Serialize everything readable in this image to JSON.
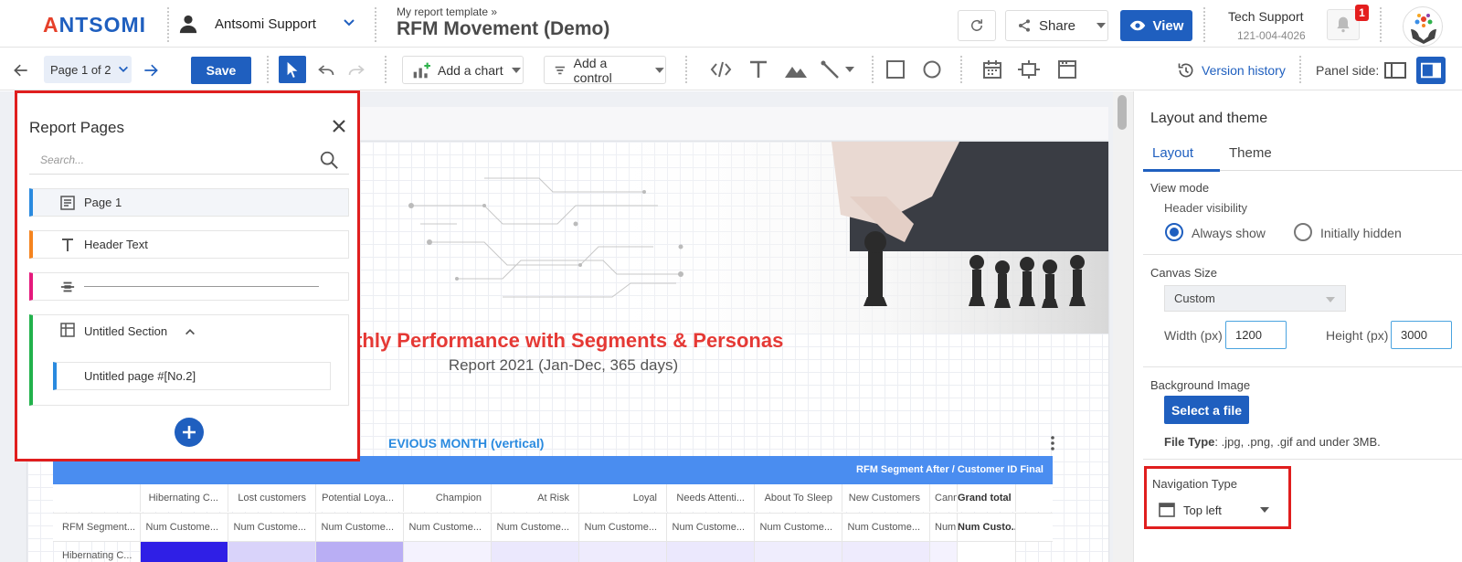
{
  "app": {
    "logo_prefix": "A",
    "logo_rest": "NTSOMI",
    "account_name": "Antsomi Support",
    "breadcrumb": "My report template »",
    "report_title": "RFM Movement (Demo)",
    "share_label": "Share",
    "view_label": "View",
    "support_name": "Tech Support",
    "support_phone": "121-004-4026",
    "notification_count": "1"
  },
  "toolbar": {
    "page_indicator": "Page 1 of 2",
    "save_label": "Save",
    "add_chart_label": "Add a chart",
    "add_control_label": "Add a control",
    "version_history_label": "Version history",
    "panel_side_label": "Panel side:"
  },
  "report_pages": {
    "title": "Report Pages",
    "search_placeholder": "Search...",
    "items": [
      {
        "label": "Page 1",
        "accent": "#2a8adf",
        "icon": "page-icon"
      },
      {
        "label": "Header Text",
        "accent": "#f5841f",
        "icon": "text-icon"
      },
      {
        "label": "",
        "accent": "#e5197c",
        "icon": "divider-icon"
      }
    ],
    "section": {
      "label": "Untitled Section",
      "accent": "#22b24c"
    },
    "sub_page": {
      "label": "Untitled page #[No.2]",
      "accent": "#2a8adf"
    }
  },
  "canvas": {
    "heading": "nthly Performance with Segments & Personas",
    "subheading": "Report 2021 (Jan-Dec, 365 days)",
    "table_title": "EVIOUS MONTH (vertical)",
    "table_header": "RFM Segment After / Customer ID Final",
    "columns": [
      "Hibernating C...",
      "Lost customers",
      "Potential Loya...",
      "Champion",
      "At Risk",
      "Loyal",
      "Needs Attenti...",
      "About To Sleep",
      "New Customers",
      "Cann",
      "Grand total"
    ],
    "row_label": "RFM Segment...",
    "metric_cells": [
      "Num Custome...",
      "Num Custome...",
      "Num Custome...",
      "Num Custome...",
      "Num Custome...",
      "Num Custome...",
      "Num Custome...",
      "Num Custome...",
      "Num Custome...",
      "Num",
      "Num Custo..."
    ],
    "partial_row_label": "Hibernating C..."
  },
  "right_panel": {
    "title": "Layout and theme",
    "tabs": [
      "Layout",
      "Theme"
    ],
    "view_mode_label": "View mode",
    "header_visibility_label": "Header visibility",
    "header_options": [
      "Always show",
      "Initially hidden"
    ],
    "header_selected": "Always show",
    "canvas_size_label": "Canvas Size",
    "canvas_size_value": "Custom",
    "width_label": "Width (px)",
    "width_value": "1200",
    "height_label": "Height (px)",
    "height_value": "3000",
    "background_image_label": "Background Image",
    "select_file_label": "Select a file",
    "file_type_label": "File Type",
    "file_type_value": ": .jpg, .png, .gif and under 3MB.",
    "navigation_type_label": "Navigation Type",
    "navigation_type_value": "Top left"
  },
  "colors": {
    "primary": "#1f5fbf",
    "highlight_border": "#e01e1e",
    "heading_red": "#e53935",
    "table_blue": "#4a8df0"
  }
}
